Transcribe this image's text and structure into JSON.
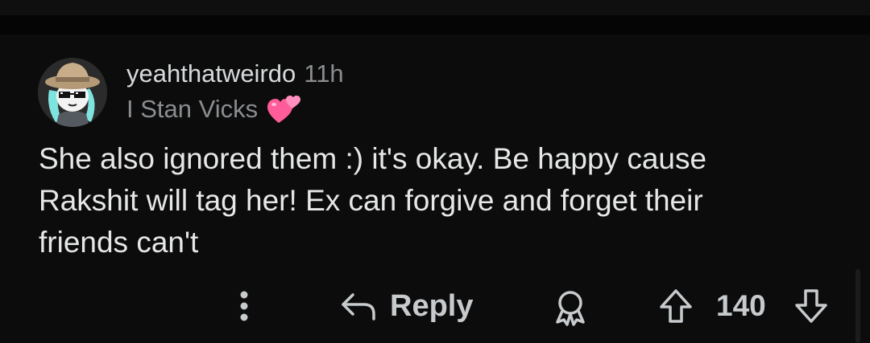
{
  "comment": {
    "author": "yeahthatweirdo",
    "timestamp": "11h",
    "flair_text": "I Stan Vicks",
    "flair_emoji": "two-hearts-emoji",
    "body": "She also ignored them :) it's okay. Be happy cause\nRakshit will tag her! Ex can forgive and forget their\nfriends can't"
  },
  "actions": {
    "more_icon": "vertical-ellipsis-icon",
    "reply_icon": "reply-arrow-icon",
    "reply_label": "Reply",
    "award_icon": "award-icon",
    "upvote_icon": "upvote-arrow-icon",
    "score": "140",
    "downvote_icon": "downvote-arrow-icon"
  },
  "colors": {
    "background": "#0c0c0c",
    "text_primary": "#e6e7e8",
    "text_muted": "#8a8d90",
    "action_text": "#c8cbcd"
  }
}
